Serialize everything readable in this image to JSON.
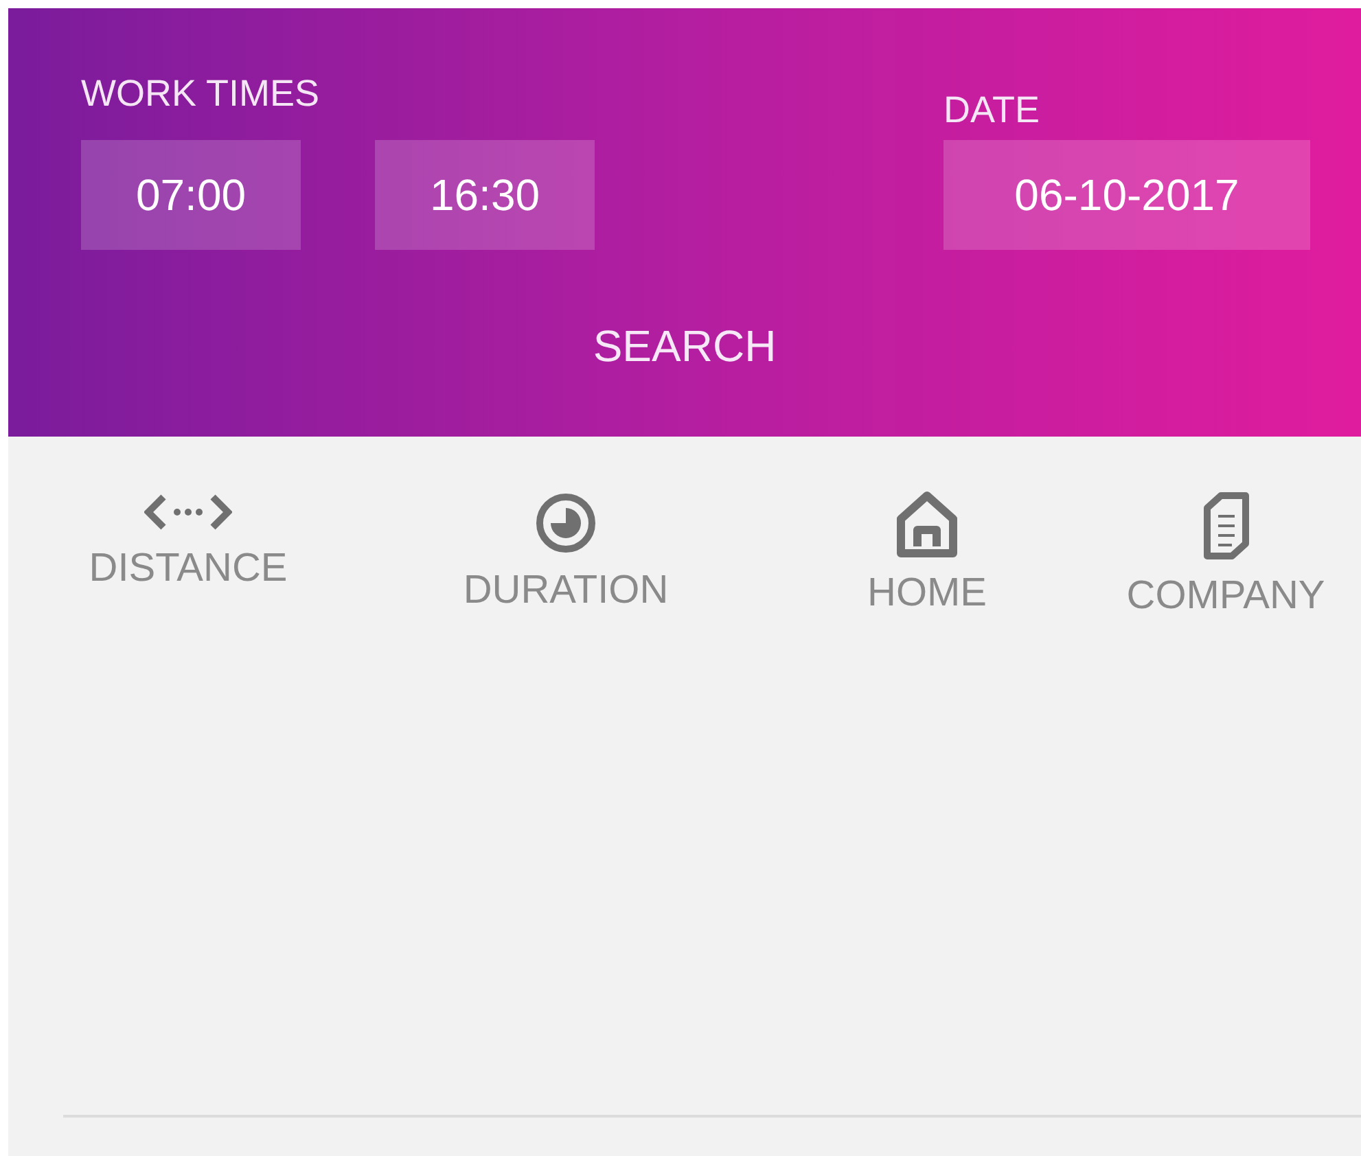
{
  "header": {
    "work_times": {
      "label": "WORK TIMES",
      "start": "07:00",
      "end": "16:30"
    },
    "date": {
      "label": "DATE",
      "value": "06-10-2017"
    },
    "search_button": "SEARCH"
  },
  "sort_options": [
    {
      "kind": "distance",
      "label": "DISTANCE"
    },
    {
      "kind": "duration",
      "label": "DURATION"
    },
    {
      "kind": "home",
      "label": "HOME"
    },
    {
      "kind": "company",
      "label": "COMPANY"
    }
  ]
}
